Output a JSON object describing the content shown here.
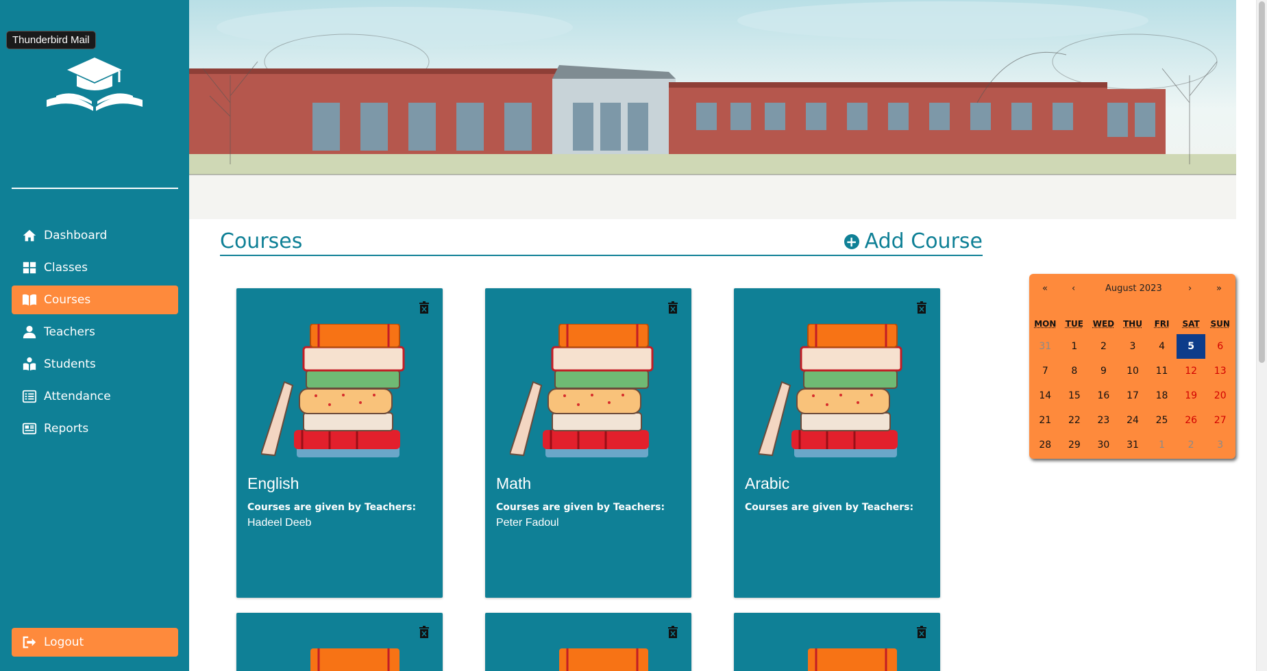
{
  "tooltip": "Thunderbird Mail",
  "sidebar": {
    "items": [
      {
        "label": "Dashboard",
        "icon": "home-icon",
        "active": false
      },
      {
        "label": "Classes",
        "icon": "grid-icon",
        "active": false
      },
      {
        "label": "Courses",
        "icon": "book-icon",
        "active": true
      },
      {
        "label": "Teachers",
        "icon": "user-icon",
        "active": false
      },
      {
        "label": "Students",
        "icon": "student-icon",
        "active": false
      },
      {
        "label": "Attendance",
        "icon": "list-icon",
        "active": false
      },
      {
        "label": "Reports",
        "icon": "newspaper-icon",
        "active": false
      }
    ],
    "logout": "Logout"
  },
  "header": {
    "title": "Courses",
    "add_label": "Add Course"
  },
  "courses": [
    {
      "name": "English",
      "subtitle": "Courses are given by Teachers:",
      "teachers": "Hadeel Deeb"
    },
    {
      "name": "Math",
      "subtitle": "Courses are given by Teachers:",
      "teachers": "Peter Fadoul"
    },
    {
      "name": "Arabic",
      "subtitle": "Courses are given by Teachers:",
      "teachers": ""
    }
  ],
  "calendar": {
    "prev_year": "«",
    "prev_month": "‹",
    "month_label": "August 2023",
    "next_month": "›",
    "next_year": "»",
    "weekdays": [
      "MON",
      "TUE",
      "WED",
      "THU",
      "FRI",
      "SAT",
      "SUN"
    ],
    "days": [
      "31",
      "1",
      "2",
      "3",
      "4",
      "5",
      "6",
      "7",
      "8",
      "9",
      "10",
      "11",
      "12",
      "13",
      "14",
      "15",
      "16",
      "17",
      "18",
      "19",
      "20",
      "21",
      "22",
      "23",
      "24",
      "25",
      "26",
      "27",
      "28",
      "29",
      "30",
      "31",
      "1",
      "2",
      "3"
    ],
    "selected_day": "5"
  },
  "colors": {
    "primary": "#0f8096",
    "accent": "#fe8a3c",
    "selected": "#0d3c8a"
  }
}
